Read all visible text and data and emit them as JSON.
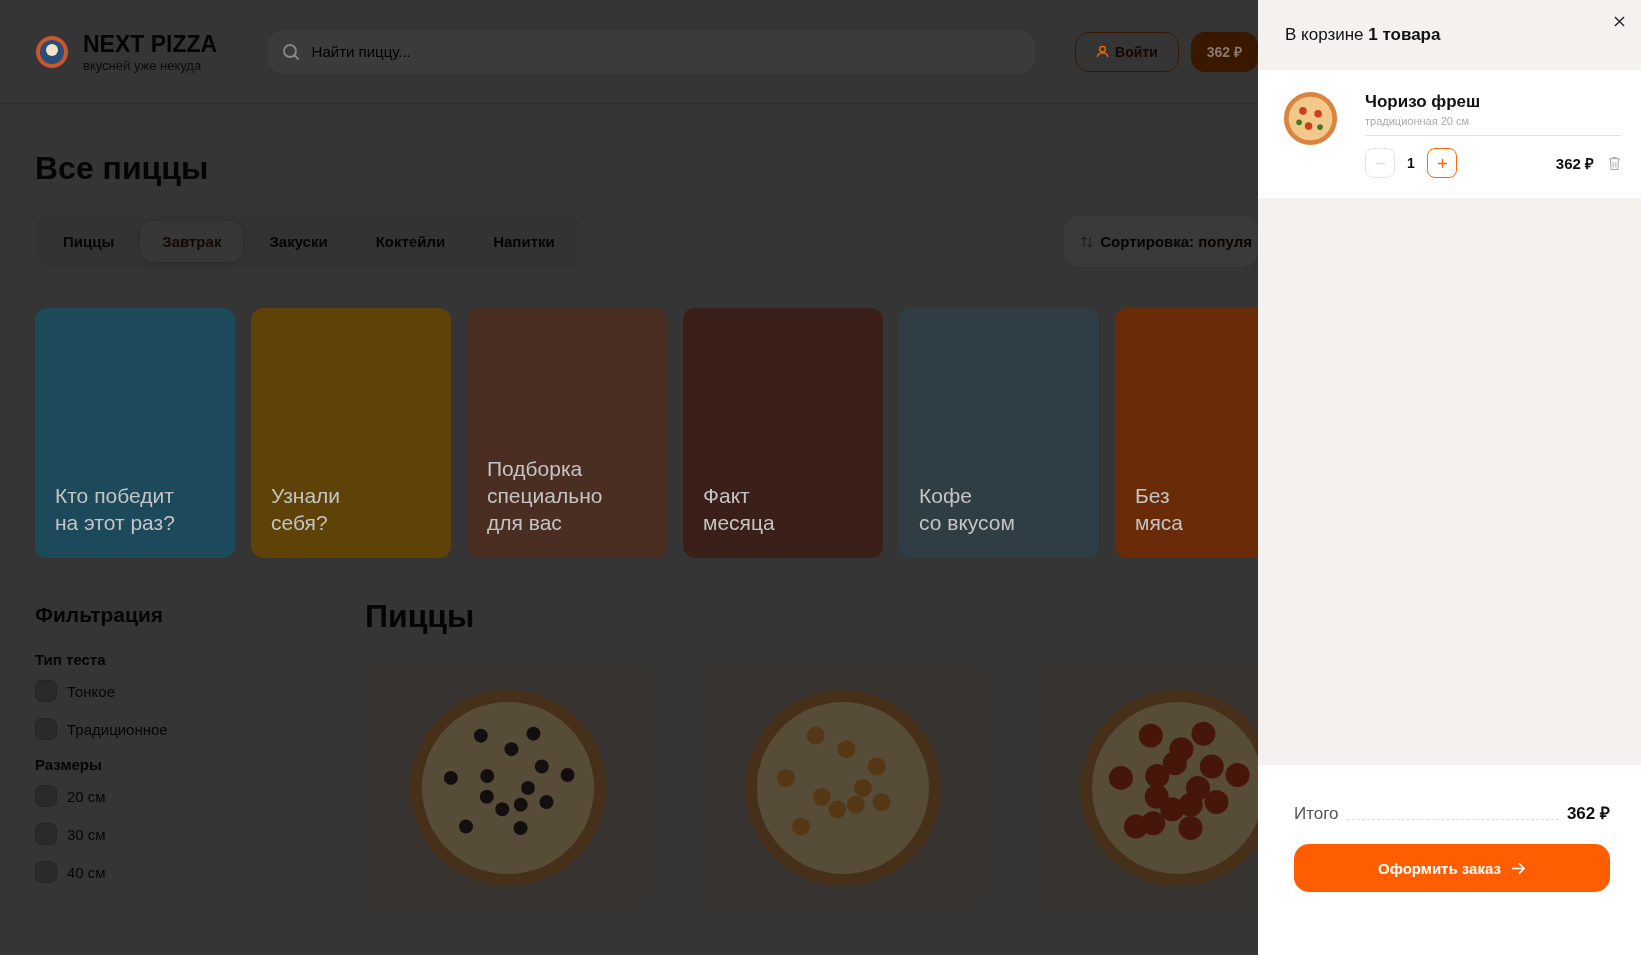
{
  "header": {
    "logo": {
      "title": "NEXT PIZZA",
      "tagline": "вкусней уже некуда"
    },
    "search": {
      "placeholder": "Найти пиццу..."
    },
    "login_button": "Войти",
    "cart_button": "362 ₽"
  },
  "page_title": "Все пиццы",
  "categories": [
    {
      "label": "Пиццы",
      "selected": false
    },
    {
      "label": "Завтрак",
      "selected": true
    },
    {
      "label": "Закуски",
      "selected": false
    },
    {
      "label": "Коктейли",
      "selected": false
    },
    {
      "label": "Напитки",
      "selected": false
    }
  ],
  "sort": {
    "label": "Сортировка:",
    "value": "популя"
  },
  "stories": [
    {
      "lines": [
        "Кто победит",
        "на этот раз?"
      ],
      "color": "#1d4a5a"
    },
    {
      "lines": [
        "Узнали",
        "себя?"
      ],
      "color": "#5f4208"
    },
    {
      "lines": [
        "Подборка",
        "специально",
        "для вас"
      ],
      "color": "#4a2e22"
    },
    {
      "lines": [
        "Факт",
        "месяца"
      ],
      "color": "#3a2018"
    },
    {
      "lines": [
        "Кофе",
        "со вкусом"
      ],
      "color": "#2f3e45"
    },
    {
      "lines": [
        "Без",
        "мяса"
      ],
      "color": "#6a2c08"
    }
  ],
  "filters": {
    "title": "Фильтрация",
    "groups": [
      {
        "title": "Тип теста",
        "options": [
          {
            "label": "Тонкое",
            "checked": false
          },
          {
            "label": "Традиционное",
            "checked": false
          }
        ]
      },
      {
        "title": "Размеры",
        "options": [
          {
            "label": "20 см",
            "checked": false
          },
          {
            "label": "30 см",
            "checked": false
          },
          {
            "label": "40 см",
            "checked": false
          }
        ]
      }
    ]
  },
  "products": {
    "title": "Пиццы",
    "items": [
      {
        "kind": "olives"
      },
      {
        "kind": "cheese"
      },
      {
        "kind": "pepperoni"
      }
    ]
  },
  "cart": {
    "title": "В корзине **1 товара**",
    "items": [
      {
        "name": "Чоризо фреш",
        "details": "традиционная 20 см",
        "quantity": "1",
        "minus_disabled": true,
        "price": "362 ₽"
      }
    ],
    "total_label": "Итого",
    "total": "362 ₽",
    "checkout_button": "Оформить заказ"
  }
}
